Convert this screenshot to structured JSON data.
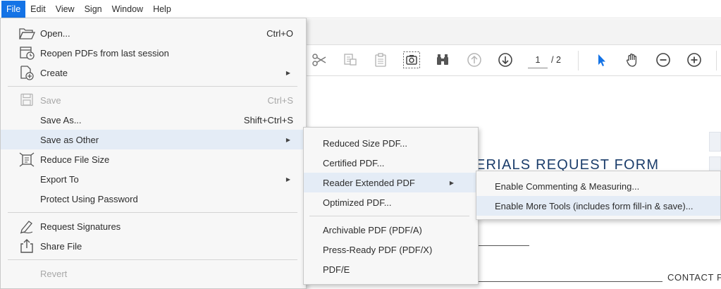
{
  "menubar": {
    "items": [
      "File",
      "Edit",
      "View",
      "Sign",
      "Window",
      "Help"
    ]
  },
  "toolbar": {
    "page_current": "1",
    "page_total": "/ 2"
  },
  "document": {
    "heading": "ERIALS REQUEST FORM",
    "contact": "CONTACT P"
  },
  "file_menu": {
    "open": {
      "label": "Open...",
      "shortcut": "Ctrl+O"
    },
    "reopen": {
      "label": "Reopen PDFs from last session"
    },
    "create": {
      "label": "Create"
    },
    "save": {
      "label": "Save",
      "shortcut": "Ctrl+S"
    },
    "save_as": {
      "label": "Save As...",
      "shortcut": "Shift+Ctrl+S"
    },
    "save_as_other": {
      "label": "Save as Other"
    },
    "reduce": {
      "label": "Reduce File Size"
    },
    "export": {
      "label": "Export To"
    },
    "protect": {
      "label": "Protect Using Password"
    },
    "request_sig": {
      "label": "Request Signatures"
    },
    "share": {
      "label": "Share File"
    },
    "revert": {
      "label": "Revert"
    }
  },
  "save_other_menu": {
    "items": [
      "Reduced Size PDF...",
      "Certified PDF...",
      "Reader Extended PDF",
      "Optimized PDF...",
      "Archivable PDF (PDF/A)",
      "Press-Ready PDF (PDF/X)",
      "PDF/E"
    ]
  },
  "reader_ext_menu": {
    "items": [
      "Enable Commenting & Measuring...",
      "Enable More Tools (includes form fill-in & save)..."
    ]
  },
  "colors": {
    "accent": "#1473e6",
    "highlight": "#e4ecf6",
    "doc_heading": "#1b3d6b"
  }
}
